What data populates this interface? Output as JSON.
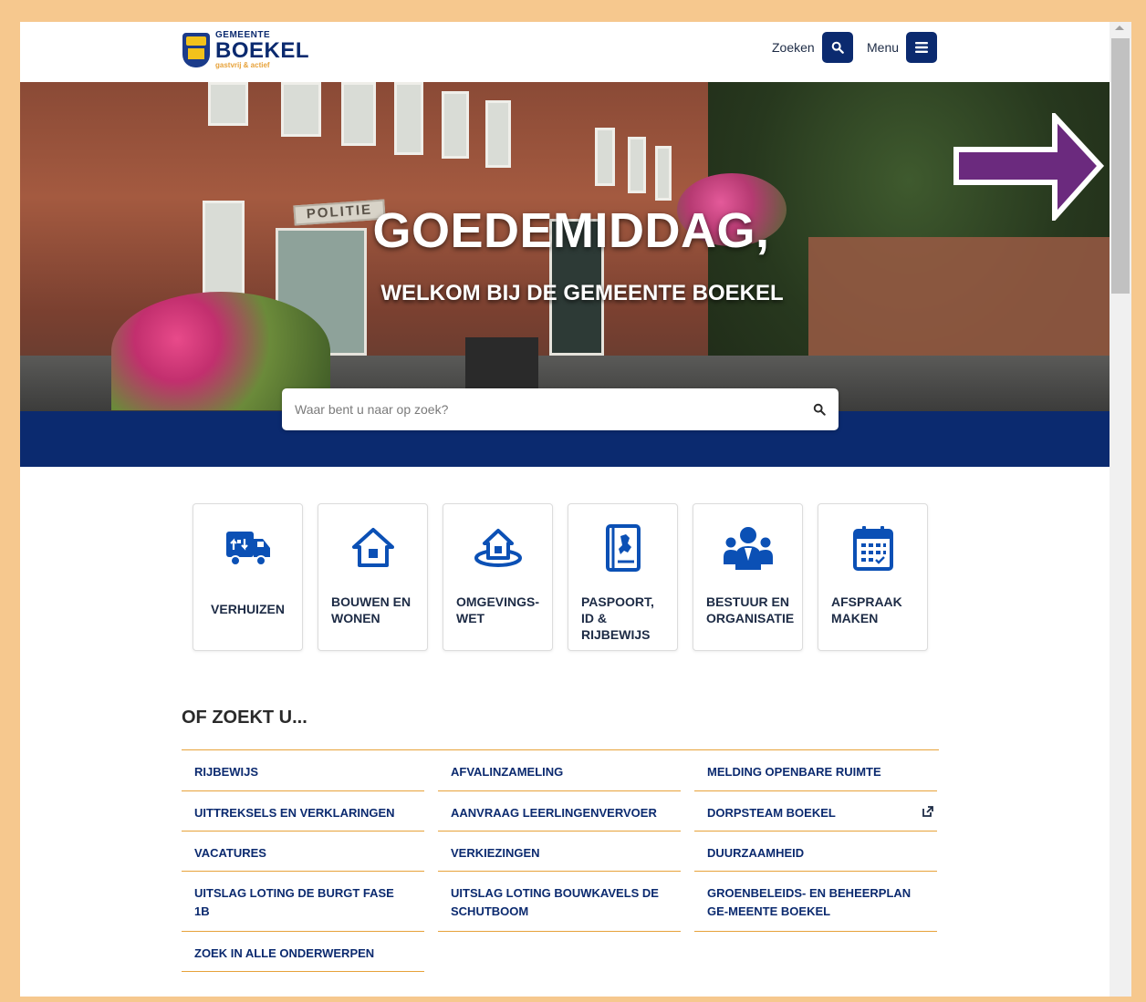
{
  "header": {
    "logo": {
      "top_text": "GEMEENTE",
      "name": "BOEKEL",
      "tagline": "gastvrij & actief"
    },
    "search_label": "Zoeken",
    "menu_label": "Menu"
  },
  "hero": {
    "title": "GOEDEMIDDAG,",
    "subtitle": "WELKOM BIJ DE GEMEENTE BOEKEL",
    "sign_text": "POLITIE",
    "search_placeholder": "Waar bent u naar op zoek?",
    "arrow_color": "#6b2a7e"
  },
  "tiles": [
    {
      "label": "VERHUIZEN",
      "icon": "moving-truck-icon"
    },
    {
      "label": "BOUWEN EN WONEN",
      "icon": "house-icon"
    },
    {
      "label": "OMGEVINGS-WET",
      "icon": "land-house-icon"
    },
    {
      "label": "PASPOORT, ID & RIJBEWIJS",
      "icon": "passport-icon"
    },
    {
      "label": "BESTUUR EN ORGANISATIE",
      "icon": "people-icon"
    },
    {
      "label": "AFSPRAAK MAKEN",
      "icon": "calendar-icon"
    }
  ],
  "quick_links": {
    "title": "OF ZOEKT U...",
    "rows": [
      [
        "RIJBEWIJS",
        "AFVALINZAMELING",
        "MELDING OPENBARE RUIMTE"
      ],
      [
        "UITTREKSELS EN VERKLARINGEN",
        "AANVRAAG LEERLINGENVERVOER",
        "DORPSTEAM BOEKEL"
      ],
      [
        "VACATURES",
        "VERKIEZINGEN",
        "DUURZAAMHEID"
      ],
      [
        "UITSLAG LOTING DE BURGT FASE 1B",
        "UITSLAG LOTING BOUWKAVELS DE SCHUTBOOM",
        "GROENBELEIDS- EN BEHEERPLAN GE-MEENTE BOEKEL"
      ],
      [
        "ZOEK IN ALLE ONDERWERPEN"
      ]
    ]
  },
  "colors": {
    "brand_navy": "#0b2a6f",
    "accent_orange": "#e7a23a",
    "frame_border": "#f6c88e"
  }
}
